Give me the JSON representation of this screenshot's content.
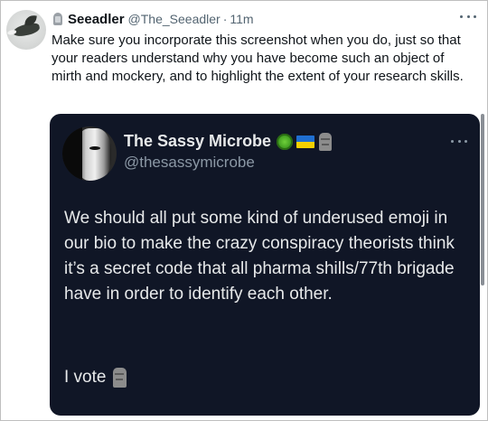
{
  "tweet": {
    "author_name": "Seeadler",
    "author_handle": "@The_Seeadler",
    "separator": "·",
    "time": "11m",
    "text": "Make sure you incorporate this screenshot when you do, just so that your readers understand why you have become such an object of mirth and mockery, and to highlight the extent of your research skills."
  },
  "quoted_tweet": {
    "author_name": "The Sassy Microbe",
    "author_handle": "@thesassymicrobe",
    "badges": [
      "microbe-icon",
      "ukraine-flag-icon",
      "moai-icon"
    ],
    "text": "We should all put some kind of underused emoji in our bio to make the crazy conspiracy theorists think it’s a secret code that all pharma shills/77th brigade have in order to identify each other.",
    "vote_text": "I vote"
  },
  "colors": {
    "quote_background": "#101626",
    "primary_text_light": "#0f1419",
    "secondary_text_light": "#536471",
    "primary_text_dark": "#e7e9ea",
    "secondary_text_dark": "#8b98a5"
  }
}
